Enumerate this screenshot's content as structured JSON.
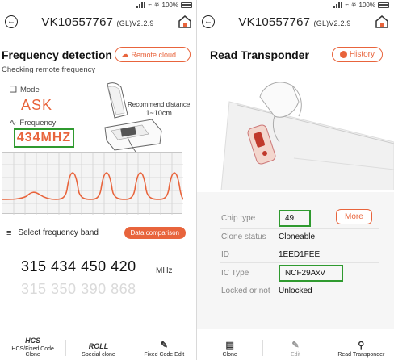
{
  "left": {
    "status_battery": "100%",
    "device_id": "VK10557767",
    "version": "(GL)V2.2.9",
    "section_title": "Frequency detection",
    "remote_button": "Remote cloud ...",
    "status_text": "Checking remote frequency",
    "mode_label": "Mode",
    "mode_value": "ASK",
    "frequency_label": "Frequency",
    "frequency_value": "434MHZ",
    "recommend_label": "Recommend distance",
    "recommend_value": "1~10cm",
    "select_band_label": "Select frequency band",
    "data_comparison_button": "Data comparison",
    "bands_row1": "315 434 450 420",
    "bands_row2": "315 350 390 868",
    "unit": "MHz",
    "tabs": [
      {
        "icon_text": "HCS",
        "label": "HCS/Fixed Code Clone"
      },
      {
        "icon_text": "ROLL",
        "label": "Special clone"
      },
      {
        "icon_text": "",
        "label": "Fixed Code Edit"
      }
    ]
  },
  "right": {
    "status_battery": "100%",
    "device_id": "VK10557767",
    "version": "(GL)V2.2.9",
    "section_title": "Read Transponder",
    "history_button": "History",
    "more_button": "More",
    "rows": [
      {
        "key": "Chip type",
        "value": "49"
      },
      {
        "key": "Clone status",
        "value": "Cloneable"
      },
      {
        "key": "ID",
        "value": "1EED1FEE"
      },
      {
        "key": "IC Type",
        "value": "NCF29AxV"
      },
      {
        "key": "Locked or not",
        "value": "Unlocked"
      }
    ],
    "tabs": [
      {
        "label": "Clone"
      },
      {
        "label": "Edit"
      },
      {
        "label": "Read Transponder"
      }
    ]
  },
  "colors": {
    "accent": "#e8643c",
    "highlight_box": "#2f9a2f"
  }
}
